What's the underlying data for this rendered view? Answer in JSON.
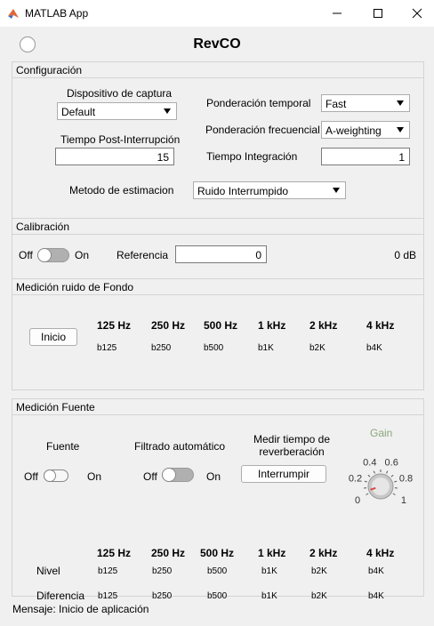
{
  "window": {
    "title": "MATLAB App"
  },
  "app": {
    "title": "RevCO"
  },
  "config": {
    "title": "Configuración",
    "device_label": "Dispositivo de captura",
    "device_value": "Default",
    "post_label": "Tiempo Post-Interrupción",
    "post_value": "15",
    "temporal_label": "Ponderación temporal",
    "temporal_value": "Fast",
    "freq_label": "Ponderación frecuencial",
    "freq_value": "A-weighting",
    "integ_label": "Tiempo Integración",
    "integ_value": "1",
    "method_label": "Metodo de estimacion",
    "method_value": "Ruido Interrumpido"
  },
  "calib": {
    "title": "Calibración",
    "off": "Off",
    "on": "On",
    "ref_label": "Referencia",
    "ref_value": "0",
    "db_value": "0 dB"
  },
  "bands": [
    "125 Hz",
    "250 Hz",
    "500 Hz",
    "1 kHz",
    "2 kHz",
    "4 kHz"
  ],
  "noise": {
    "title": "Medición ruido de Fondo",
    "start": "Inicio",
    "values": [
      "b125",
      "b250",
      "b500",
      "b1K",
      "b2K",
      "b4K"
    ]
  },
  "source": {
    "title": "Medición Fuente",
    "fuente_label": "Fuente",
    "auto_label": "Filtrado automático",
    "off": "Off",
    "on": "On",
    "rev_label_1": "Medir tiempo de",
    "rev_label_2": "reverberación",
    "interrupt": "Interrumpir",
    "gain_label": "Gain",
    "gain_ticks": [
      "0",
      "0.2",
      "0.4",
      "0.6",
      "0.8",
      "1"
    ],
    "gain_value": 0.05,
    "nivel_label": "Nivel",
    "diff_label": "Diferencia",
    "nivel": [
      "b125",
      "b250",
      "b500",
      "b1K",
      "b2K",
      "b4K"
    ],
    "diff": [
      "b125",
      "b250",
      "b500",
      "b1K",
      "b2K",
      "b4K"
    ]
  },
  "message": "Mensaje: Inicio de aplicación",
  "colors": {
    "gain_label": "#8aa87a",
    "knob": "#c8c8c8",
    "accent": "#d44"
  }
}
